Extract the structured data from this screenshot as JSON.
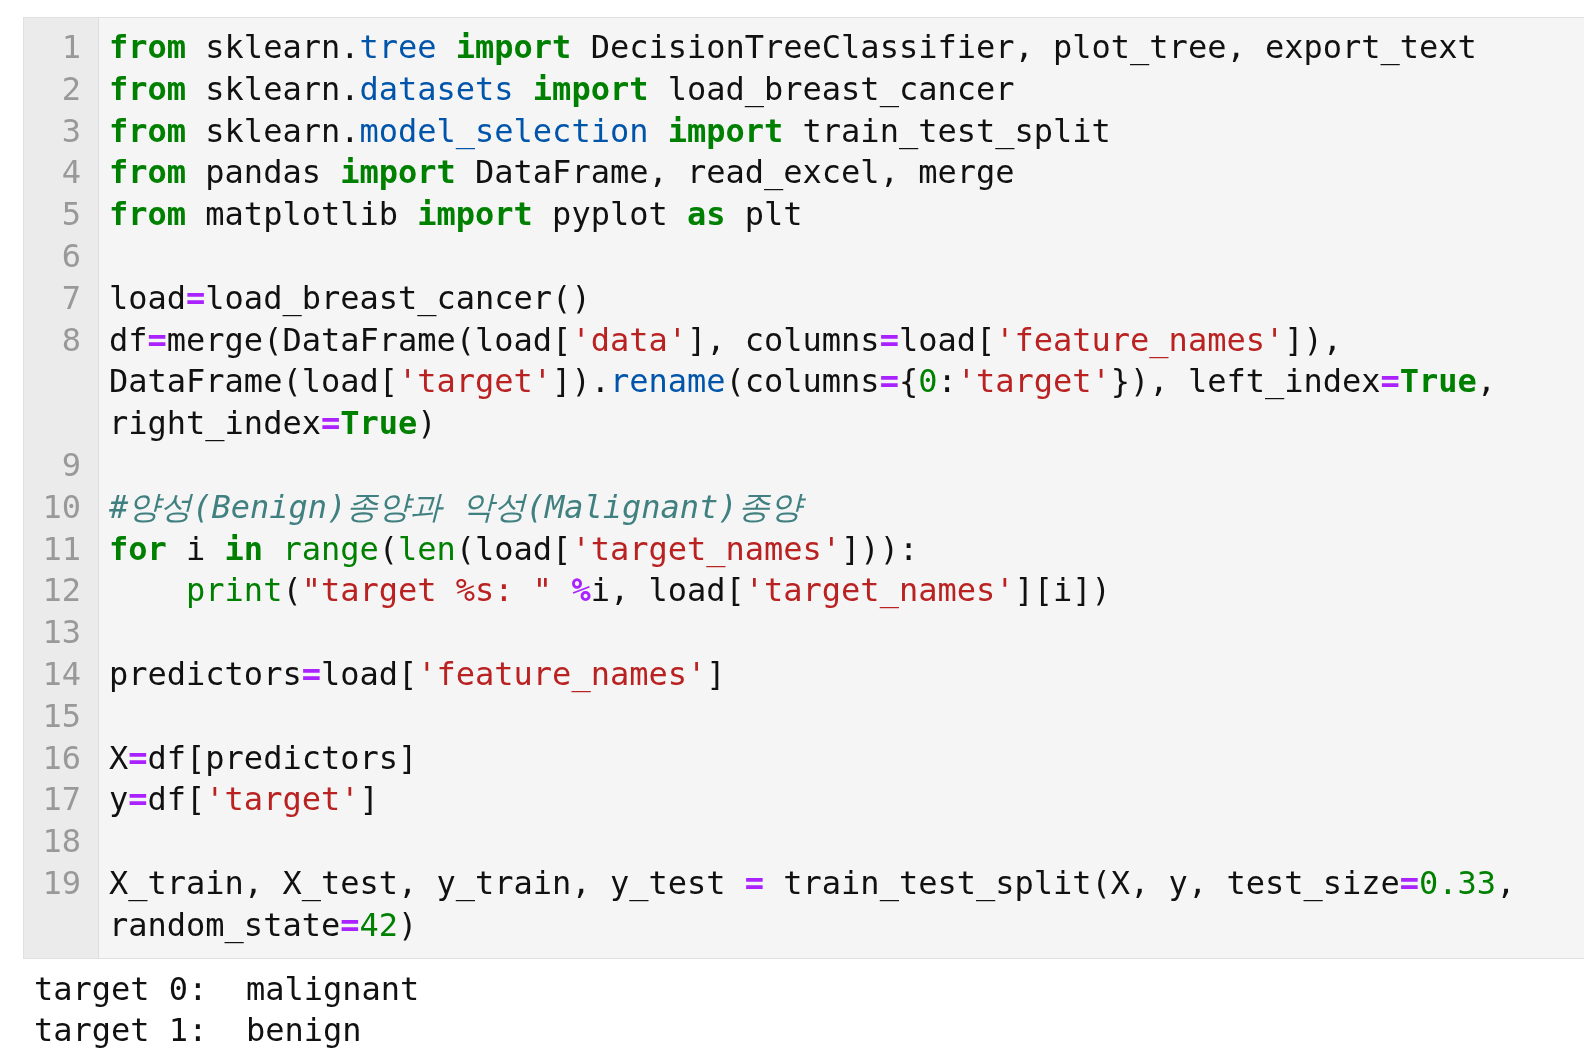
{
  "cell": {
    "lines": [
      {
        "number": "1",
        "wrapped": [
          {
            "tokens": [
              {
                "kind": "kw",
                "text": "from"
              },
              {
                "kind": "plain",
                "text": " sklearn."
              },
              {
                "kind": "mod",
                "text": "tree"
              },
              {
                "kind": "kw",
                "text": " import"
              },
              {
                "kind": "plain",
                "text": " DecisionTreeClassifier, plot_tree, export_text"
              }
            ]
          }
        ]
      },
      {
        "number": "2",
        "wrapped": [
          {
            "tokens": [
              {
                "kind": "kw",
                "text": "from"
              },
              {
                "kind": "plain",
                "text": " sklearn."
              },
              {
                "kind": "mod",
                "text": "datasets"
              },
              {
                "kind": "kw",
                "text": " import"
              },
              {
                "kind": "plain",
                "text": " load_breast_cancer"
              }
            ]
          }
        ]
      },
      {
        "number": "3",
        "wrapped": [
          {
            "tokens": [
              {
                "kind": "kw",
                "text": "from"
              },
              {
                "kind": "plain",
                "text": " sklearn."
              },
              {
                "kind": "mod",
                "text": "model_selection"
              },
              {
                "kind": "kw",
                "text": " import"
              },
              {
                "kind": "plain",
                "text": " train_test_split"
              }
            ]
          }
        ]
      },
      {
        "number": "4",
        "wrapped": [
          {
            "tokens": [
              {
                "kind": "kw",
                "text": "from"
              },
              {
                "kind": "plain",
                "text": " pandas "
              },
              {
                "kind": "kw",
                "text": "import"
              },
              {
                "kind": "plain",
                "text": " DataFrame, read_excel, merge"
              }
            ]
          }
        ]
      },
      {
        "number": "5",
        "wrapped": [
          {
            "tokens": [
              {
                "kind": "kw",
                "text": "from"
              },
              {
                "kind": "plain",
                "text": " matplotlib "
              },
              {
                "kind": "kw",
                "text": "import"
              },
              {
                "kind": "plain",
                "text": " pyplot "
              },
              {
                "kind": "kw",
                "text": "as"
              },
              {
                "kind": "plain",
                "text": " plt"
              }
            ]
          }
        ]
      },
      {
        "number": "6"
      },
      {
        "number": "7",
        "wrapped": [
          {
            "tokens": [
              {
                "kind": "plain",
                "text": "load"
              },
              {
                "kind": "op",
                "text": "="
              },
              {
                "kind": "plain",
                "text": "load_breast_cancer()"
              }
            ]
          }
        ]
      },
      {
        "number": "8",
        "wrapped": [
          {
            "tokens": [
              {
                "kind": "plain",
                "text": "df"
              },
              {
                "kind": "op",
                "text": "="
              },
              {
                "kind": "plain",
                "text": "merge(DataFrame(load["
              },
              {
                "kind": "str",
                "text": "'data'"
              },
              {
                "kind": "plain",
                "text": "], columns"
              },
              {
                "kind": "op",
                "text": "="
              },
              {
                "kind": "plain",
                "text": "load["
              },
              {
                "kind": "str",
                "text": "'feature_names'"
              },
              {
                "kind": "plain",
                "text": "]),"
              }
            ]
          },
          {
            "tokens": [
              {
                "kind": "plain",
                "text": "DataFrame(load["
              },
              {
                "kind": "str",
                "text": "'target'"
              },
              {
                "kind": "plain",
                "text": "])."
              },
              {
                "kind": "mod",
                "text": "rename"
              },
              {
                "kind": "plain",
                "text": "(columns"
              },
              {
                "kind": "op",
                "text": "="
              },
              {
                "kind": "plain",
                "text": "{"
              },
              {
                "kind": "num",
                "text": "0"
              },
              {
                "kind": "plain",
                "text": ":"
              },
              {
                "kind": "str",
                "text": "'target'"
              },
              {
                "kind": "plain",
                "text": "}), left_index"
              },
              {
                "kind": "op",
                "text": "="
              },
              {
                "kind": "kw",
                "text": "True"
              },
              {
                "kind": "plain",
                "text": ","
              }
            ]
          },
          {
            "tokens": [
              {
                "kind": "plain",
                "text": "right_index"
              },
              {
                "kind": "op",
                "text": "="
              },
              {
                "kind": "kw",
                "text": "True"
              },
              {
                "kind": "plain",
                "text": ")"
              }
            ]
          }
        ]
      },
      {
        "number": "9"
      },
      {
        "number": "10",
        "wrapped": [
          {
            "tokens": [
              {
                "kind": "comment",
                "text": "#양성(Benign)종양과 악성(Malignant)종양"
              }
            ]
          }
        ]
      },
      {
        "number": "11",
        "wrapped": [
          {
            "tokens": [
              {
                "kind": "kw",
                "text": "for"
              },
              {
                "kind": "plain",
                "text": " i "
              },
              {
                "kind": "kw",
                "text": "in"
              },
              {
                "kind": "builtin",
                "text": " range"
              },
              {
                "kind": "plain",
                "text": "("
              },
              {
                "kind": "builtin",
                "text": "len"
              },
              {
                "kind": "plain",
                "text": "(load["
              },
              {
                "kind": "str",
                "text": "'target_names'"
              },
              {
                "kind": "plain",
                "text": "])):"
              }
            ]
          }
        ]
      },
      {
        "number": "12",
        "wrapped": [
          {
            "tokens": [
              {
                "kind": "builtin",
                "text": "    print"
              },
              {
                "kind": "plain",
                "text": "("
              },
              {
                "kind": "str",
                "text": "\"target %s: \""
              },
              {
                "kind": "op",
                "text": " %"
              },
              {
                "kind": "plain",
                "text": "i, load["
              },
              {
                "kind": "str",
                "text": "'target_names'"
              },
              {
                "kind": "plain",
                "text": "][i])"
              }
            ]
          }
        ]
      },
      {
        "number": "13"
      },
      {
        "number": "14",
        "wrapped": [
          {
            "tokens": [
              {
                "kind": "plain",
                "text": "predictors"
              },
              {
                "kind": "op",
                "text": "="
              },
              {
                "kind": "plain",
                "text": "load["
              },
              {
                "kind": "str",
                "text": "'feature_names'"
              },
              {
                "kind": "plain",
                "text": "]"
              }
            ]
          }
        ]
      },
      {
        "number": "15"
      },
      {
        "number": "16",
        "wrapped": [
          {
            "tokens": [
              {
                "kind": "plain",
                "text": "X"
              },
              {
                "kind": "op",
                "text": "="
              },
              {
                "kind": "plain",
                "text": "df[predictors]"
              }
            ]
          }
        ]
      },
      {
        "number": "17",
        "wrapped": [
          {
            "tokens": [
              {
                "kind": "plain",
                "text": "y"
              },
              {
                "kind": "op",
                "text": "="
              },
              {
                "kind": "plain",
                "text": "df["
              },
              {
                "kind": "str",
                "text": "'target'"
              },
              {
                "kind": "plain",
                "text": "]"
              }
            ]
          }
        ]
      },
      {
        "number": "18"
      },
      {
        "number": "19",
        "wrapped": [
          {
            "tokens": [
              {
                "kind": "plain",
                "text": "X_train, X_test, y_train, y_test "
              },
              {
                "kind": "op",
                "text": "="
              },
              {
                "kind": "plain",
                "text": " train_test_split(X, y, test_size"
              },
              {
                "kind": "op",
                "text": "="
              },
              {
                "kind": "num",
                "text": "0.33"
              },
              {
                "kind": "plain",
                "text": ","
              }
            ]
          },
          {
            "tokens": [
              {
                "kind": "plain",
                "text": "random_state"
              },
              {
                "kind": "op",
                "text": "="
              },
              {
                "kind": "num",
                "text": "42"
              },
              {
                "kind": "plain",
                "text": ")"
              }
            ]
          }
        ]
      }
    ]
  },
  "output": [
    "target 0:  malignant",
    "target 1:  benign"
  ]
}
